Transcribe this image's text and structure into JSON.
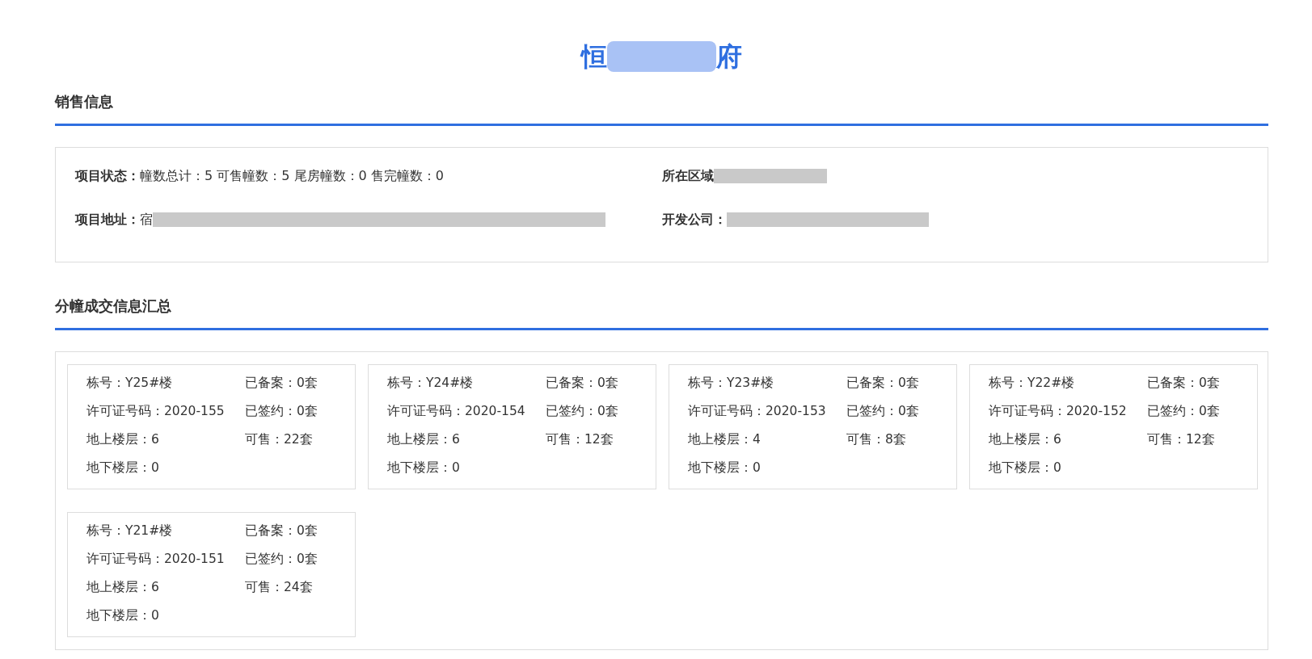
{
  "title": {
    "before_mask": "恒",
    "after_mask": "府"
  },
  "sales_section": {
    "heading": "销售信息",
    "fields": [
      {
        "label": "项目状态：",
        "value": "幢数总计：5 可售幢数：5 尾房幢数：0 售完幢数：0",
        "masked": false
      },
      {
        "label": "所在区域",
        "masked": true
      },
      {
        "label": "项目地址：",
        "value": "宿",
        "masked": true
      },
      {
        "label": "开发公司：",
        "masked": true
      }
    ]
  },
  "buildings_section": {
    "heading": "分幢成交信息汇总",
    "cards": [
      {
        "left": [
          "栋号：Y25#楼",
          "许可证号码：2020-155",
          "地上楼层：6",
          "地下楼层：0"
        ],
        "right": [
          "已备案：0套",
          "已签约：0套",
          "可售：22套"
        ]
      },
      {
        "left": [
          "栋号：Y24#楼",
          "许可证号码：2020-154",
          "地上楼层：6",
          "地下楼层：0"
        ],
        "right": [
          "已备案：0套",
          "已签约：0套",
          "可售：12套"
        ]
      },
      {
        "left": [
          "栋号：Y23#楼",
          "许可证号码：2020-153",
          "地上楼层：4",
          "地下楼层：0"
        ],
        "right": [
          "已备案：0套",
          "已签约：0套",
          "可售：8套"
        ]
      },
      {
        "left": [
          "栋号：Y22#楼",
          "许可证号码：2020-152",
          "地上楼层：6",
          "地下楼层：0"
        ],
        "right": [
          "已备案：0套",
          "已签约：0套",
          "可售：12套"
        ]
      },
      {
        "left": [
          "栋号：Y21#楼",
          "许可证号码：2020-151",
          "地上楼层：6",
          "地下楼层：0"
        ],
        "right": [
          "已备案：0套",
          "已签约：0套",
          "可售：24套"
        ]
      }
    ]
  }
}
